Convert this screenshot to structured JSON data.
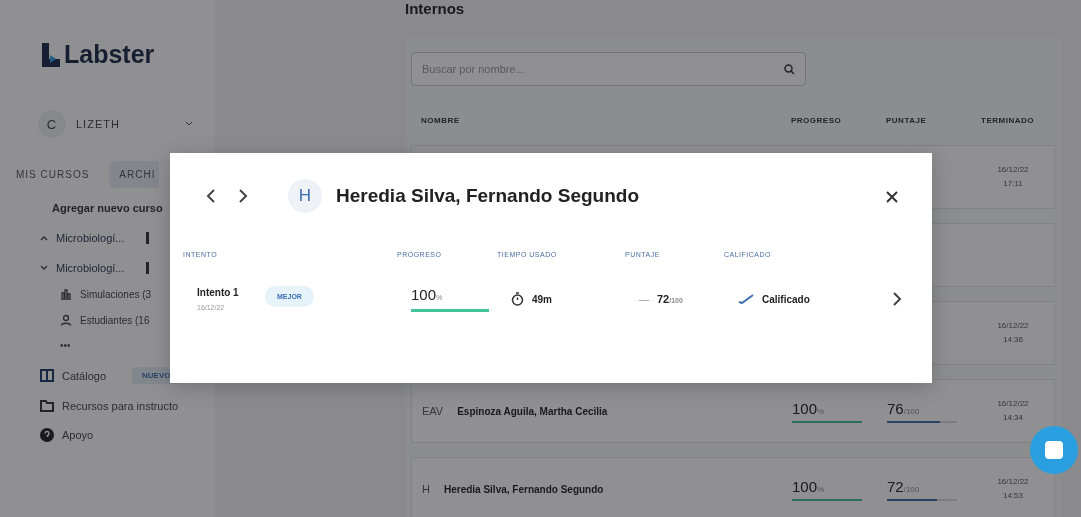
{
  "sidebar": {
    "logo": "Labster",
    "user": {
      "initial": "C",
      "name": "LIZETH"
    },
    "tabs": [
      {
        "label": "MIS CURSOS",
        "selected": false
      },
      {
        "label": "ARCHI",
        "selected": true
      }
    ],
    "add_course": "Agregar nuevo curso",
    "courses": [
      {
        "label": "Microbiologí...",
        "expanded": false
      },
      {
        "label": "Microbiologí...",
        "expanded": true,
        "children": [
          {
            "label": "Simulaciones (3",
            "kind": "flask"
          },
          {
            "label": "Estudiantes (16",
            "kind": "person"
          },
          {
            "label": "•••",
            "kind": "more"
          }
        ]
      }
    ],
    "nav": [
      {
        "label": "Catálogo",
        "kind": "book",
        "badge": "NUEVO"
      },
      {
        "label": "Recursos para instructo",
        "kind": "folder"
      },
      {
        "label": "Apoyo",
        "kind": "help"
      }
    ]
  },
  "main": {
    "title": "Internos",
    "search": {
      "placeholder": "Buscar por nombre..."
    },
    "columns": [
      "NOMBRE",
      "PROGRESO",
      "PUNTAJE",
      "TERMINADO"
    ],
    "rows": [
      {
        "terminado": [
          "16/12/22",
          "17:11"
        ]
      },
      {},
      {
        "terminado": [
          "16/12/22",
          "14:36"
        ]
      },
      {
        "initials": "EAV",
        "name": "Espinoza Aguila, Martha Cecilia",
        "progress": "100",
        "progress_unit": "%",
        "progress_bar": {
          "level": 1
        },
        "score": "76",
        "score_unit": "/100",
        "score_bar": {
          "level": 0.76
        },
        "terminado": [
          "16/12/22",
          "14:34"
        ]
      },
      {
        "initials": "H",
        "name": "Heredia Silva, Fernando Segundo",
        "progress": "100",
        "progress_unit": "%",
        "progress_bar": {
          "level": 1
        },
        "score": "72",
        "score_unit": "/100",
        "score_bar": {
          "level": 0.72
        },
        "terminado": [
          "16/12/22",
          "14:53"
        ]
      }
    ]
  },
  "dialog": {
    "initial": "H",
    "title": "Heredia Silva, Fernando Segundo",
    "columns": [
      "INTENTO",
      "PROGRESO",
      "TIEMPO USADO",
      "PUNTAJE",
      "CALIFICADO"
    ],
    "attempts": [
      {
        "name": "Intento 1",
        "badge": "MEJOR",
        "date": "16/12/22",
        "progress": "100",
        "progress_unit": "%",
        "level": 1,
        "time": "49m",
        "score_prefix": "—",
        "score": "72",
        "score_unit": "/100",
        "graded": true,
        "status": "Calificado"
      }
    ]
  }
}
